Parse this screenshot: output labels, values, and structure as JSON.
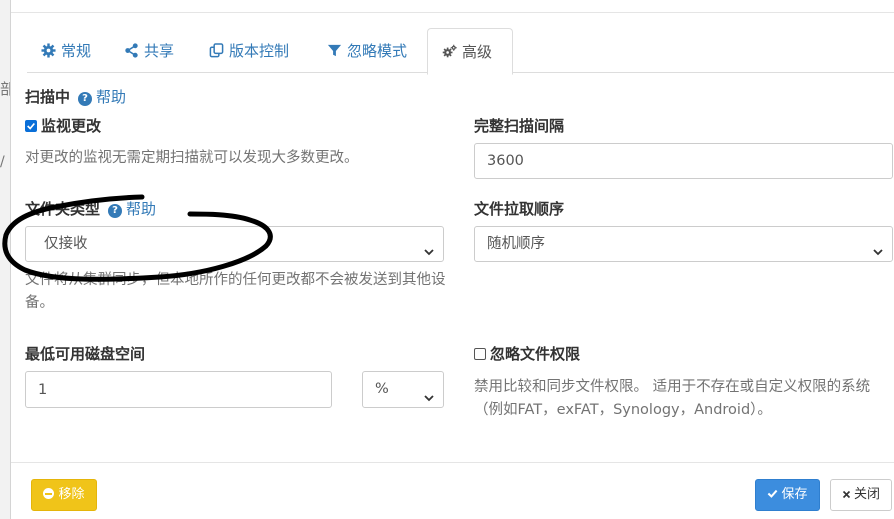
{
  "tabs": [
    {
      "label": "常规",
      "icon": "gear-icon"
    },
    {
      "label": "共享",
      "icon": "share-icon"
    },
    {
      "label": "版本控制",
      "icon": "copy-icon"
    },
    {
      "label": "忽略模式",
      "icon": "filter-icon"
    },
    {
      "label": "高级",
      "icon": "cogs-icon",
      "active": true
    }
  ],
  "scanning": {
    "label": "扫描中",
    "help": "帮助",
    "watch_label": "监视更改",
    "watch_checked": true,
    "watch_desc": "对更改的监视无需定期扫描就可以发现大多数更改。",
    "rescan_label": "完整扫描间隔",
    "rescan_value": "3600"
  },
  "folder_type": {
    "label": "文件夹类型",
    "help": "帮助",
    "value": "仅接收",
    "desc": "文件将从集群同步，但本地所作的任何更改都不会被发送到其他设备。"
  },
  "pull_order": {
    "label": "文件拉取顺序",
    "value": "随机顺序"
  },
  "min_disk": {
    "label": "最低可用磁盘空间",
    "value": "1",
    "unit": "%"
  },
  "ignore_perms": {
    "label": "忽略文件权限",
    "checked": false,
    "desc": "禁用比较和同步文件权限。 适用于不存在或自定义权限的系统（例如FAT，exFAT，Synology，Android）。"
  },
  "footer": {
    "remove": "移除",
    "save": "保存",
    "close": "关闭"
  },
  "backdrop": {
    "ghost_char": "部",
    "ghost_char2": "/"
  },
  "colors": {
    "link": "#337ab7",
    "primary": "#3c8dde",
    "warning": "#f0c419"
  }
}
